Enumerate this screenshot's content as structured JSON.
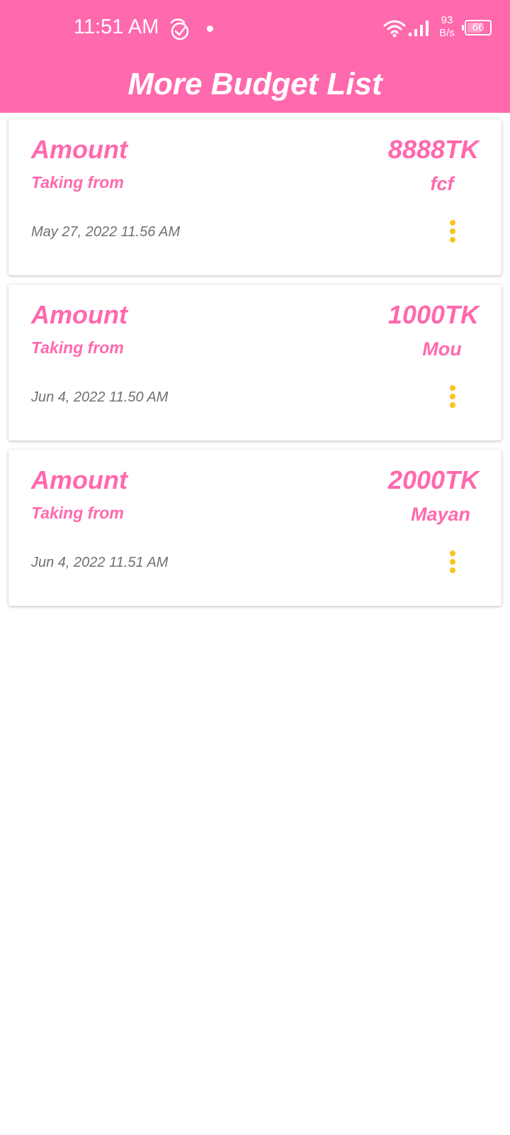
{
  "status_bar": {
    "time": "11:51 AM",
    "net_speed_value": "93",
    "net_speed_unit": "B/s",
    "battery_level": "66",
    "battery_fraction": 0.66,
    "icons": [
      "app-check-icon",
      "dot-icon",
      "wifi-icon",
      "signal-icon",
      "battery-icon"
    ]
  },
  "app_bar": {
    "title": "More Budget List"
  },
  "colors": {
    "accent": "#ff69ad",
    "date_text": "#707070",
    "menu_dots": "#f9c41f"
  },
  "budget_items": [
    {
      "amount_label": "Amount",
      "amount_value": "8888TK",
      "from_label": "Taking from",
      "from_value": "fcf",
      "date": "May 27, 2022 11.56 AM",
      "menu_icon": "more-vert-icon"
    },
    {
      "amount_label": "Amount",
      "amount_value": "1000TK",
      "from_label": "Taking from",
      "from_value": "Mou",
      "date": "Jun 4, 2022 11.50 AM",
      "menu_icon": "more-vert-icon"
    },
    {
      "amount_label": "Amount",
      "amount_value": "2000TK",
      "from_label": "Taking from",
      "from_value": "Mayan",
      "date": "Jun 4, 2022 11.51 AM",
      "menu_icon": "more-vert-icon"
    }
  ]
}
